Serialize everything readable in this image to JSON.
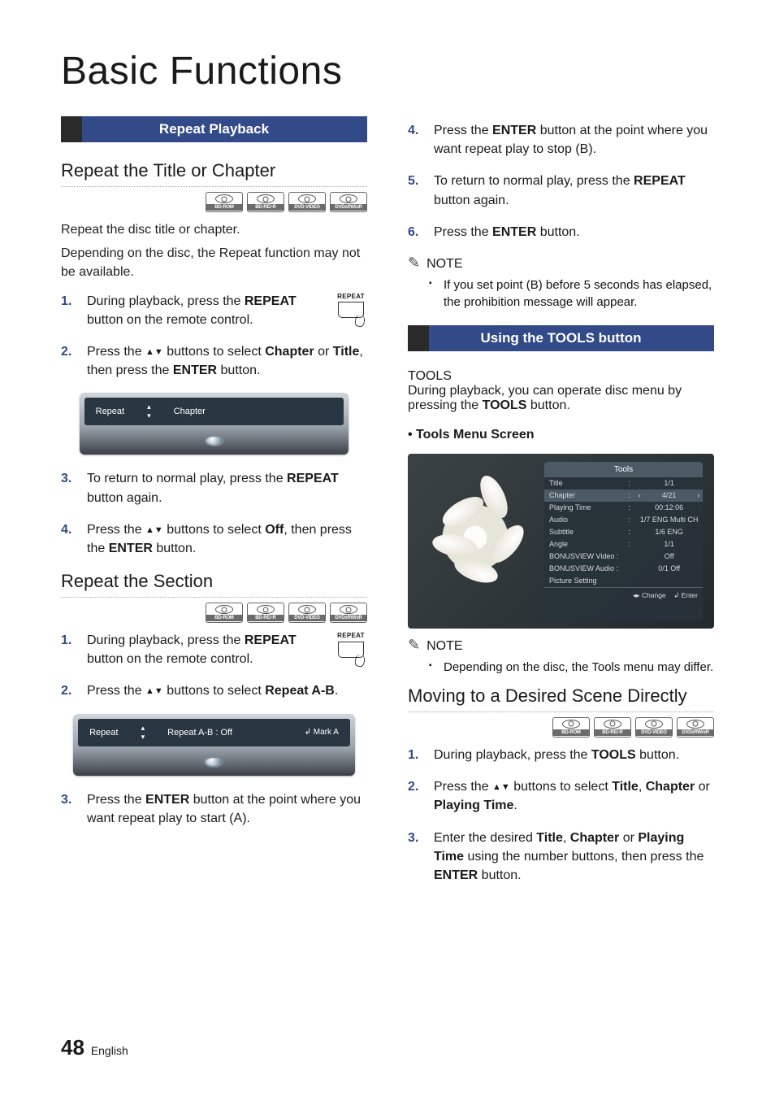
{
  "page": {
    "title": "Basic Functions",
    "number": "48",
    "language": "English"
  },
  "discTypes": [
    "BD-ROM",
    "BD-RE/-R",
    "DVD-VIDEO",
    "DVD±RW/±R"
  ],
  "icons": {
    "note": "✎",
    "up_down": "▲▼",
    "left_right": "‹ ›",
    "enter_sym": "↲"
  },
  "common": {
    "note_label": "NOTE",
    "enter": "ENTER",
    "repeat": "REPEAT",
    "tools": "TOOLS"
  },
  "left": {
    "sectionBar": "Repeat Playback",
    "sub1": "Repeat the Title or Chapter",
    "p1": "Repeat the disc title or chapter.",
    "p2": "Depending on the disc, the Repeat function may not be available.",
    "steps1": [
      {
        "pre": "During playback, press the ",
        "b1": "REPEAT",
        "post": " button on the remote control."
      },
      {
        "pre": "Press the ",
        "arrows": true,
        "mid": " buttons to select ",
        "b1": "Chapter",
        "mid2": " or ",
        "b2": "Title",
        "mid3": ", then press the ",
        "b3": "ENTER",
        "post": " button."
      },
      {
        "pre": "To return to normal play, press the ",
        "b1": "REPEAT",
        "post": " button again."
      },
      {
        "pre": "Press the ",
        "arrows": true,
        "mid": " buttons to select ",
        "b1": "Off",
        "mid2": ", then press the ",
        "b2": "ENTER",
        "post": " button."
      }
    ],
    "osd1": {
      "label": "Repeat",
      "value": "Chapter"
    },
    "sub2": "Repeat the Section",
    "steps2": [
      {
        "pre": "During playback, press the ",
        "b1": "REPEAT",
        "post": " button on the remote control."
      },
      {
        "pre": "Press the ",
        "arrows": true,
        "mid": " buttons to select ",
        "b1": "Repeat A-B",
        "post": "."
      },
      {
        "pre": "Press the ",
        "b1": "ENTER",
        "post": " button at the point where you want repeat play to start (A)."
      }
    ],
    "osd2": {
      "label": "Repeat",
      "value": "Repeat A-B : Off",
      "btn": "Mark A"
    }
  },
  "right": {
    "steps_cont": [
      {
        "n": "4.",
        "pre": "Press the ",
        "b1": "ENTER",
        "post": " button at the point where you want repeat play to stop (B)."
      },
      {
        "n": "5.",
        "pre": "To return to normal play, press the ",
        "b1": "REPEAT",
        "post": " button again."
      },
      {
        "n": "6.",
        "pre": "Press the ",
        "b1": "ENTER",
        "post": " button."
      }
    ],
    "note1": "If you set point (B) before 5 seconds has elapsed, the prohibition message will appear.",
    "sectionBar": "Using the TOOLS button",
    "p1a": "During playback, you can operate disc menu by pressing the ",
    "p1b": " button.",
    "bulletHead": "Tools Menu Screen",
    "toolsPanel": {
      "header": "Tools",
      "rows": [
        {
          "k": "Title",
          "v": "1/1"
        },
        {
          "k": "Chapter",
          "v": "4/21",
          "sel": true
        },
        {
          "k": "Playing Time",
          "v": "00:12:06"
        },
        {
          "k": "Audio",
          "v": "1/7 ENG Multi CH"
        },
        {
          "k": "Subtitle",
          "v": "1/6 ENG"
        },
        {
          "k": "Angle",
          "v": "1/1"
        },
        {
          "k": "BONUSVIEW Video :",
          "v": "Off",
          "noColon": true
        },
        {
          "k": "BONUSVIEW Audio :",
          "v": "0/1 Off",
          "noColon": true
        },
        {
          "k": "Picture Setting",
          "v": "",
          "noColon": true
        }
      ],
      "footer_change": "Change",
      "footer_enter": "Enter"
    },
    "note2": "Depending on the disc, the Tools menu may differ.",
    "sub2": "Moving to a Desired Scene Directly",
    "steps3": [
      {
        "n": "1.",
        "pre": "During playback, press the ",
        "b1": "TOOLS",
        "post": " button."
      },
      {
        "n": "2.",
        "pre": "Press the ",
        "arrows": true,
        "mid": " buttons to select ",
        "b1": "Title",
        "mid2": ", ",
        "b2": "Chapter",
        "mid3": " or ",
        "b3": "Playing Time",
        "post": "."
      },
      {
        "n": "3.",
        "pre": "Enter the desired ",
        "b1": "Title",
        "mid": ", ",
        "b2": "Chapter",
        "mid2": " or ",
        "b3": "Playing Time",
        "mid3": " using the number buttons, then press the ",
        "b4": "ENTER",
        "post": " button."
      }
    ]
  }
}
